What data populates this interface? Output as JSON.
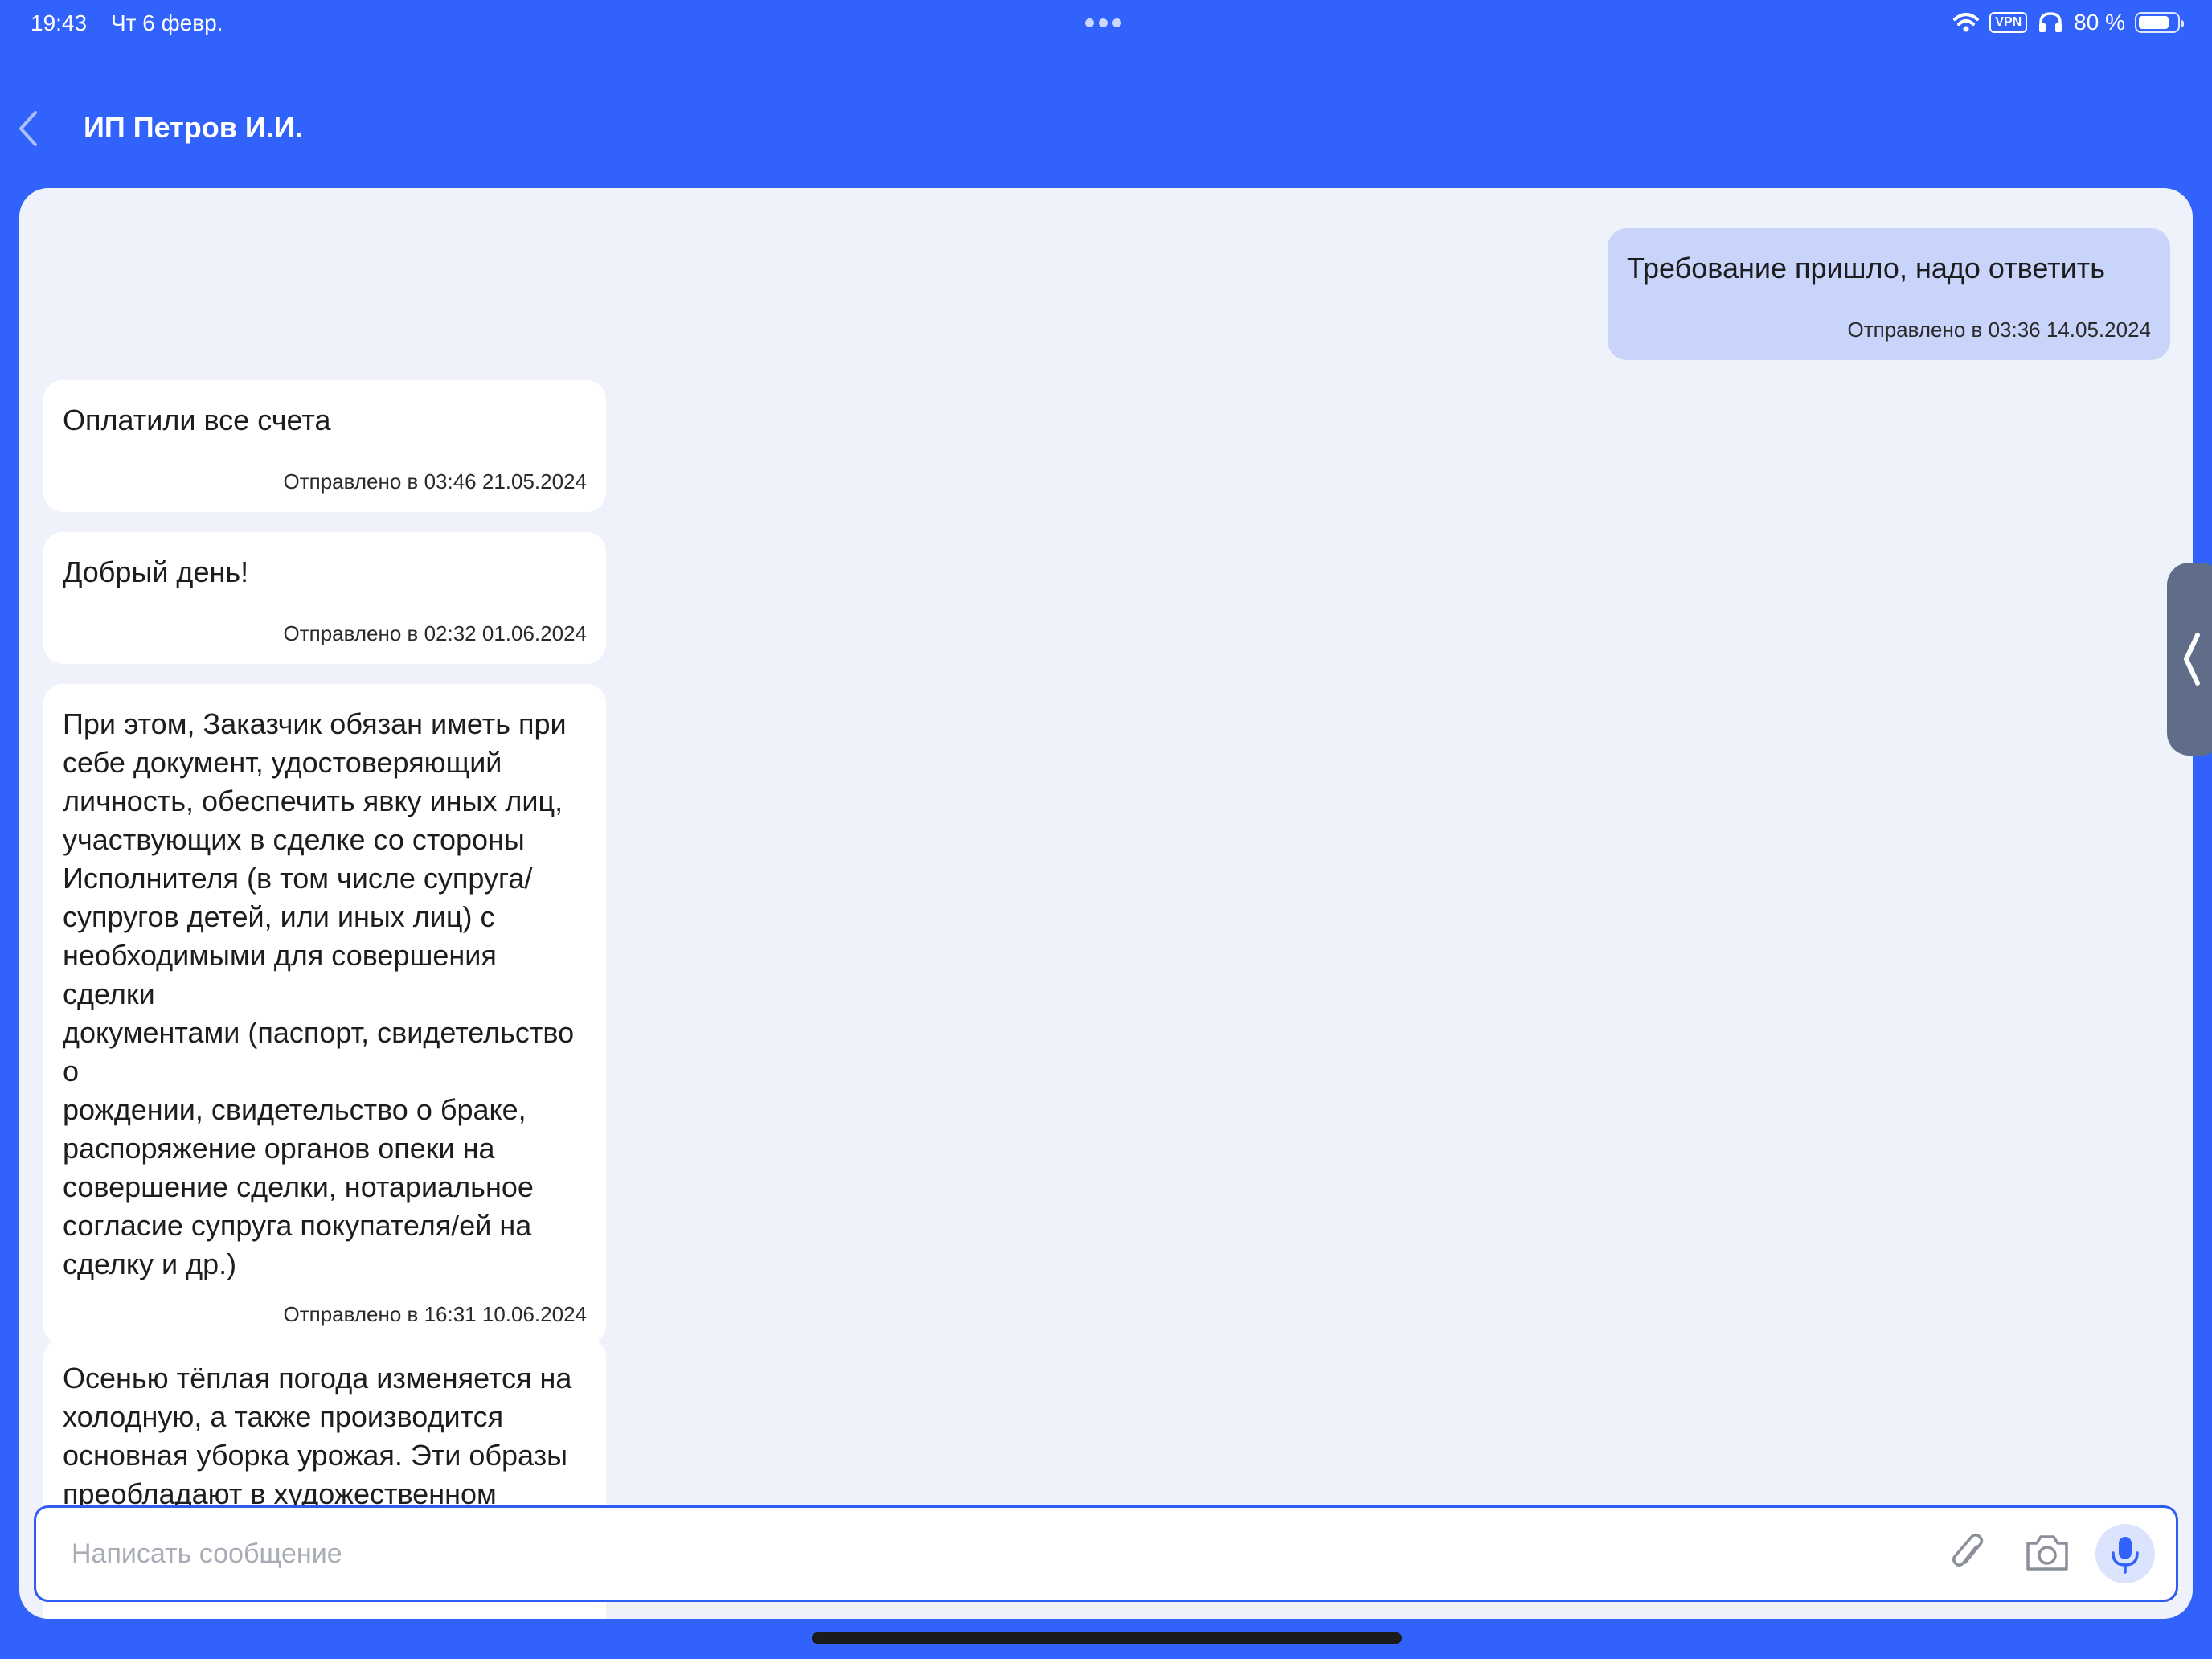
{
  "status_bar": {
    "time": "19:43",
    "date": "Чт 6 февр.",
    "vpn": "VPN",
    "battery_text": "80 %",
    "battery_level": 0.8
  },
  "header": {
    "title": "ИП Петров И.И."
  },
  "messages": [
    {
      "direction": "out",
      "text": "Требование пришло, надо ответить",
      "meta": "Отправлено в 03:36  14.05.2024"
    },
    {
      "direction": "in",
      "text": "Оплатили все счета",
      "meta": "Отправлено в 03:46  21.05.2024"
    },
    {
      "direction": "in",
      "text": "Добрый день!",
      "meta": "Отправлено в 02:32  01.06.2024"
    },
    {
      "direction": "in",
      "text": "При этом, Заказчик обязан иметь при\nсебе документ, удостоверяющий\nличность, обеспечить явку иных лиц,\nучаствующих в сделке со стороны\nИсполнителя (в том числе супруга/\nсупругов детей, или иных лиц) с\nнеобходимыми для совершения сделки\nдокументами (паспорт, свидетельство о\nрождении, свидетельство о браке,\nраспоряжение органов опеки на\nсовершение сделки, нотариальное\nсогласие супруга покупателя/ей на\nсделку и др.)",
      "meta": "Отправлено в 16:31  10.06.2024"
    },
    {
      "direction": "in",
      "text": "Осенью тёплая погода изменяется на\nхолодную, а также производится\nосновная уборка урожая. Эти образы\nпреобладают в художественном",
      "meta": ""
    }
  ],
  "composer": {
    "placeholder": "Написать сообщение"
  },
  "colors": {
    "accent": "#3162FB",
    "outgoing_bubble": "#C9D4FB",
    "incoming_bubble": "#FFFFFF",
    "panel_bg": "#EFF2FB"
  }
}
